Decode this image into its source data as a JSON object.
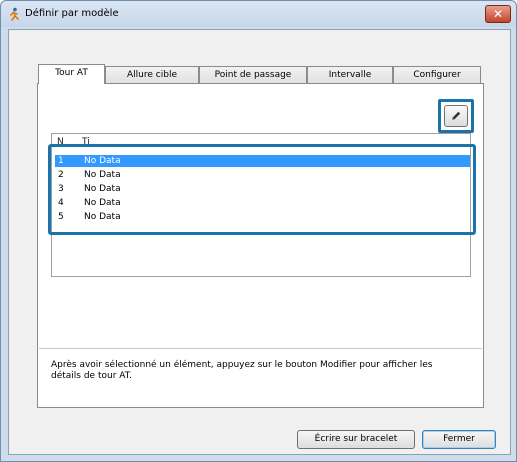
{
  "window": {
    "title": "Définir par modèle",
    "close_glyph": "✕",
    "app_icon": "running-figure-icon"
  },
  "tabs": [
    {
      "label": "Tour AT",
      "active": true
    },
    {
      "label": "Allure cible",
      "active": false
    },
    {
      "label": "Point de passage",
      "active": false
    },
    {
      "label": "Intervalle",
      "active": false
    },
    {
      "label": "Configurer",
      "active": false
    }
  ],
  "edit_button": {
    "icon": "pencil-icon"
  },
  "list": {
    "columns": [
      "N",
      "Ti"
    ],
    "rows": [
      {
        "num": "1",
        "name": "No Data",
        "selected": true
      },
      {
        "num": "2",
        "name": "No Data",
        "selected": false
      },
      {
        "num": "3",
        "name": "No Data",
        "selected": false
      },
      {
        "num": "4",
        "name": "No Data",
        "selected": false
      },
      {
        "num": "5",
        "name": "No Data",
        "selected": false
      }
    ]
  },
  "hint": "Après avoir sélectionné un élément, appuyez sur le bouton Modifier pour afficher les détails de tour AT.",
  "buttons": {
    "write": "Écrire sur bracelet",
    "close": "Fermer"
  },
  "colors": {
    "highlight": "#1a74ab",
    "selection": "#3399ff"
  }
}
